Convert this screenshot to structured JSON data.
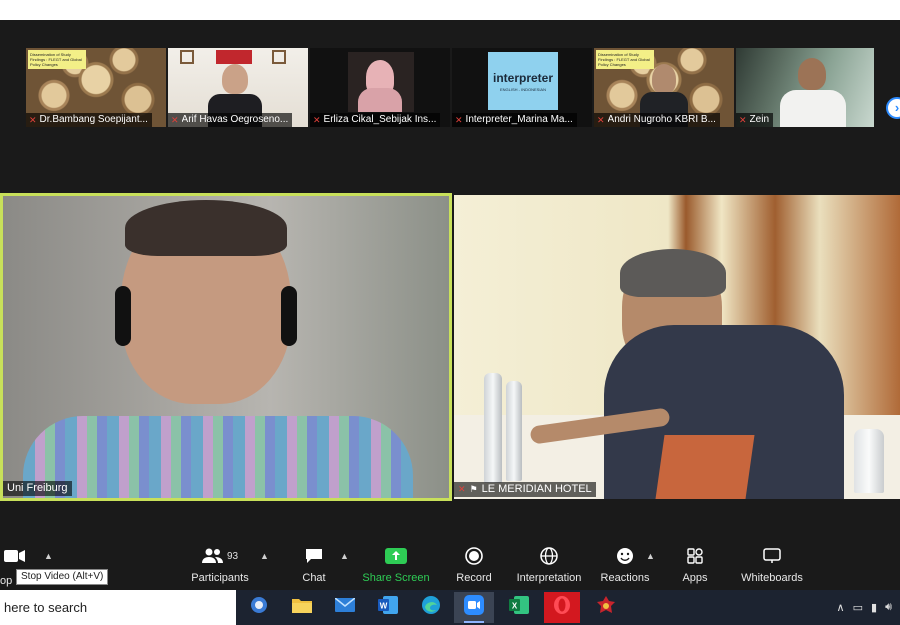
{
  "thumbnails": [
    {
      "name": "Dr.Bambang Soepijant...",
      "slide_text": "Dissemination of Study Findings : FLEGT and Global Policy Changes"
    },
    {
      "name": "Arif Havas Oegroseno..."
    },
    {
      "name": "Erliza Cikal_Sebijak Ins..."
    },
    {
      "name": "Interpreter_Marina Ma...",
      "logo_title": "interpreter",
      "logo_sub": "ENGLISH - INDONESIAN"
    },
    {
      "name": "Andri Nugroho KBRI B...",
      "slide_text": "Dissemination of Study Findings : FLEGT and Global Policy Changes"
    },
    {
      "name": "Zein"
    }
  ],
  "next_page_icon": "chevron-right-icon",
  "videos": {
    "left": {
      "name": "Uni Freiburg"
    },
    "right": {
      "name": "LE MERIDIAN HOTEL"
    }
  },
  "controls": {
    "stop_video_cut": "op",
    "tooltip": "Stop Video (Alt+V)",
    "participants": {
      "label": "Participants",
      "count": "93"
    },
    "chat": {
      "label": "Chat"
    },
    "share_screen": {
      "label": "Share Screen"
    },
    "record": {
      "label": "Record"
    },
    "interpretation": {
      "label": "Interpretation"
    },
    "reactions": {
      "label": "Reactions"
    },
    "apps": {
      "label": "Apps"
    },
    "whiteboards": {
      "label": "Whiteboards"
    }
  },
  "taskbar": {
    "search_text": "here to search",
    "apps": [
      "app-icon",
      "file-explorer-icon",
      "mail-icon",
      "word-icon",
      "edge-icon",
      "zoom-icon",
      "excel-icon",
      "opera-icon",
      "game-icon"
    ]
  },
  "colors": {
    "active_speaker_border": "#c8e05a",
    "share_green": "#2ecc55",
    "muted_red": "#e0413b",
    "accent_blue": "#2d8cff"
  }
}
